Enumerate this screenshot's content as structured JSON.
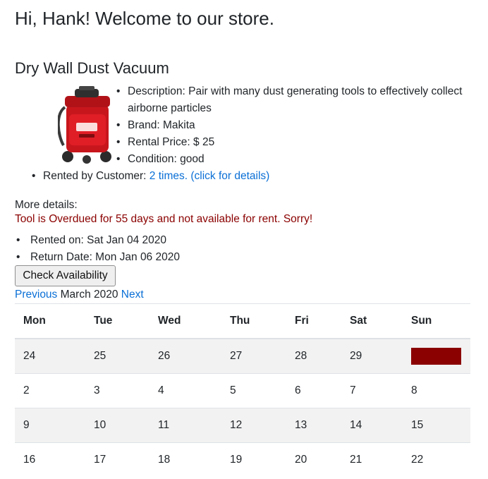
{
  "greeting": "Hi, Hank! Welcome to our store.",
  "tool": {
    "title": "Dry Wall Dust Vacuum",
    "image_alt": "red dust vacuum",
    "details": [
      "Description: Pair with many dust generating tools to effectively collect airborne particles",
      "Brand: Makita",
      "Rental Price: $ 25",
      "Condition: good"
    ],
    "rented_by_label": "Rented by Customer: ",
    "rented_by_link": "2 times. (click for details)"
  },
  "more_details": {
    "label": "More details:",
    "overdue_message": "Tool is Overdued for 55 days and not available for rent. Sorry!",
    "rented_on": "Rented on: Sat Jan 04 2020",
    "return_date": "Return Date: Mon Jan 06 2020"
  },
  "check_button_label": "Check Availability",
  "calendar": {
    "prev_label": "Previous",
    "month_label": " March 2020 ",
    "next_label": "Next",
    "weekdays": [
      "Mon",
      "Tue",
      "Wed",
      "Thu",
      "Fri",
      "Sat",
      "Sun"
    ],
    "weeks": [
      [
        "24",
        "25",
        "26",
        "27",
        "28",
        "29",
        ""
      ],
      [
        "2",
        "3",
        "4",
        "5",
        "6",
        "7",
        "8"
      ],
      [
        "9",
        "10",
        "11",
        "12",
        "13",
        "14",
        "15"
      ],
      [
        "16",
        "17",
        "18",
        "19",
        "20",
        "21",
        "22"
      ]
    ],
    "booked_color": "#8b0000"
  },
  "colors": {
    "link": "#0a6fd6",
    "overdue": "#8b0000",
    "stripe": "#f2f2f2"
  }
}
